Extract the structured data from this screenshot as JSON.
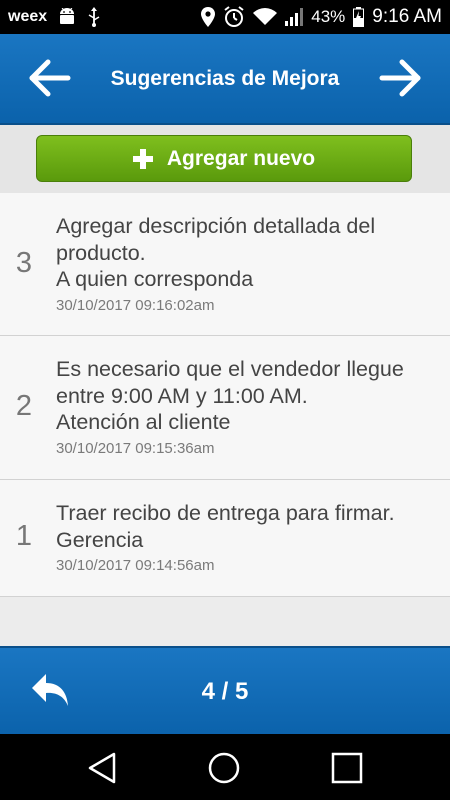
{
  "status_bar": {
    "app_name": "weex",
    "battery": "43%",
    "time": "9:16 AM"
  },
  "header": {
    "title": "Sugerencias de Mejora"
  },
  "add_button": {
    "label": "Agregar nuevo"
  },
  "items": [
    {
      "number": "3",
      "lines": [
        "Agregar descripción detallada del producto.",
        "A quien corresponda"
      ],
      "date": "30/10/2017 09:16:02am"
    },
    {
      "number": "2",
      "lines": [
        "Es necesario que el vendedor llegue entre 9:00 AM y 11:00 AM.",
        "Atención al cliente"
      ],
      "date": "30/10/2017 09:15:36am"
    },
    {
      "number": "1",
      "lines": [
        "Traer recibo de entrega para firmar.",
        "Gerencia"
      ],
      "date": "30/10/2017 09:14:56am"
    }
  ],
  "footer": {
    "page": "4 / 5"
  },
  "colors": {
    "header_blue": "#1a76c2",
    "button_green": "#6fae14"
  }
}
